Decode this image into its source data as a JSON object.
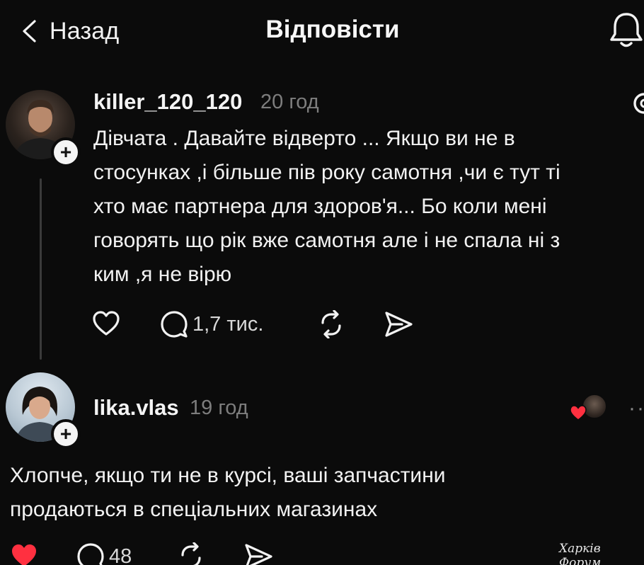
{
  "header": {
    "back_label": "Назад",
    "title": "Відповісти"
  },
  "post": {
    "username": "killer_120_120",
    "time": "20 год",
    "text": "Дівчата . Давайте відверто ... Якщо ви не в\nстосунках ,і більше пів року самотня ,чи є тут ті\nхто має партнера для здоров'я... Бо коли мені\nговорять що рік вже самотня але і не спала ні з\nким ,я не вірю",
    "replies_count": "1,7 тис.",
    "icons": [
      "heart-icon",
      "comment-icon",
      "repost-icon",
      "share-icon",
      "threads-icon"
    ]
  },
  "reply": {
    "username": "lika.vlas",
    "time": "19 год",
    "text": "Хлопче, якщо ти не в курсі, ваші запчастини\nпродаються в спеціальних магазинах",
    "replies_count": "48",
    "liked": true,
    "like_color": "#ff3040"
  },
  "watermark": "Харків Форум",
  "colors": {
    "background": "#0b0b0b",
    "text": "#f2f2f2",
    "muted": "#7d7d7d",
    "like": "#ff3040"
  }
}
